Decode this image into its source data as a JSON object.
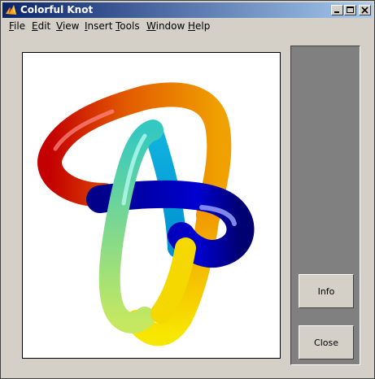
{
  "window": {
    "title": "Colorful Knot",
    "icon": "matlab-icon",
    "controls": [
      "minimize-icon",
      "maximize-icon",
      "close-icon"
    ]
  },
  "menu": {
    "items": [
      {
        "label": "File",
        "mnemonic": "F"
      },
      {
        "label": "Edit",
        "mnemonic": "E"
      },
      {
        "label": "View",
        "mnemonic": "V"
      },
      {
        "label": "Insert",
        "mnemonic": "I"
      },
      {
        "label": "Tools",
        "mnemonic": "T"
      },
      {
        "label": "Window",
        "mnemonic": "W"
      },
      {
        "label": "Help",
        "mnemonic": "H"
      }
    ]
  },
  "panel": {
    "info_label": "Info",
    "close_label": "Close"
  },
  "colors": {
    "titlebar_start": "#0a246a",
    "titlebar_end": "#a6caf0",
    "face": "#d4d0c8",
    "panel": "#808080"
  }
}
